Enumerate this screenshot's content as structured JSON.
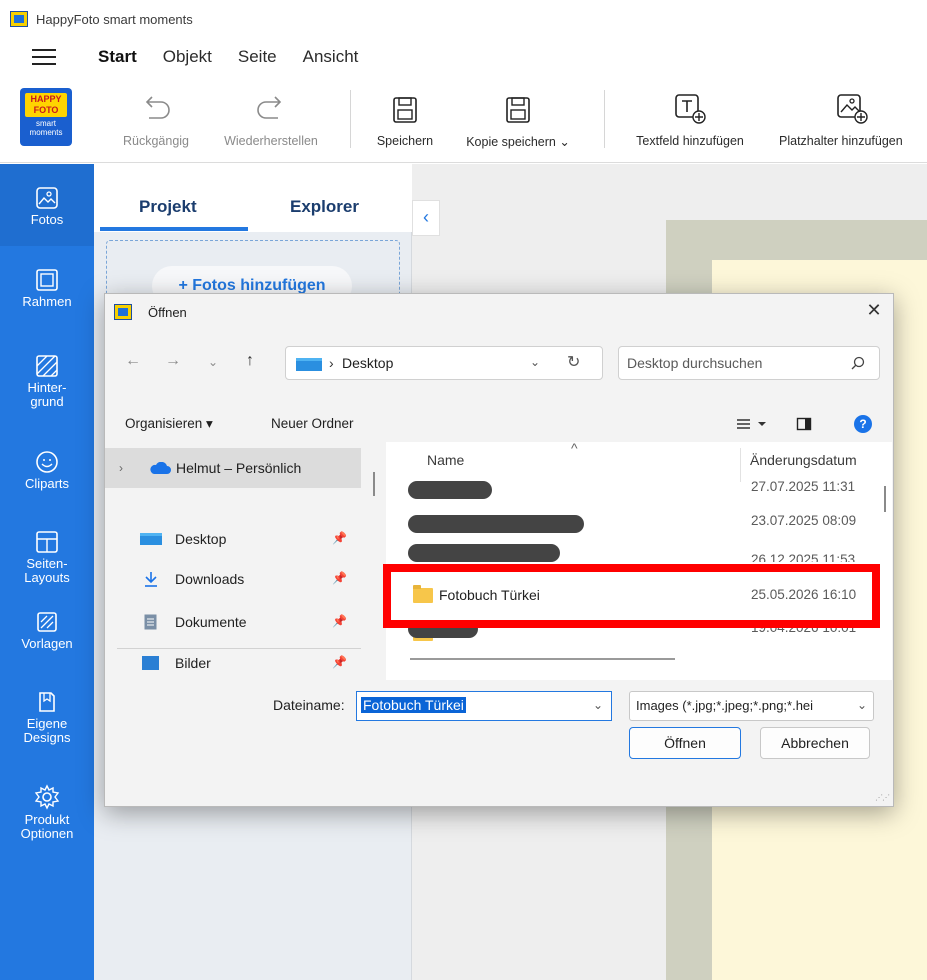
{
  "app": {
    "title": "HappyFoto smart moments"
  },
  "menu": {
    "tabs": [
      "Start",
      "Objekt",
      "Seite",
      "Ansicht"
    ]
  },
  "logo": {
    "top": "HAPPY FOTO",
    "bottom": "smart moments"
  },
  "toolbar": {
    "undo": "Rückgängig",
    "redo": "Wiederherstellen",
    "save": "Speichern",
    "save_copy": "Kopie speichern ⌄",
    "add_textfield": "Textfeld hinzufügen",
    "add_placeholder": "Platzhalter hinzufügen"
  },
  "sidebar": {
    "items": [
      {
        "label": "Fotos",
        "icon": "photo-icon"
      },
      {
        "label": "Rahmen",
        "icon": "frame-icon"
      },
      {
        "label": "Hinter-\ngrund",
        "icon": "background-icon"
      },
      {
        "label": "Cliparts",
        "icon": "clipart-icon"
      },
      {
        "label": "Seiten-\nLayouts",
        "icon": "layout-icon"
      },
      {
        "label": "Vorlagen",
        "icon": "template-icon"
      },
      {
        "label": "Eigene\nDesigns",
        "icon": "designs-icon"
      },
      {
        "label": "Produkt\nOptionen",
        "icon": "settings-icon"
      }
    ]
  },
  "panel": {
    "tabs": [
      "Projekt",
      "Explorer"
    ],
    "add_photos": "+ Fotos hinzufügen"
  },
  "dialog": {
    "title": "Öffnen",
    "address": "Desktop",
    "search_placeholder": "Desktop durchsuchen",
    "organize": "Organisieren ▾",
    "new_folder": "Neuer Ordner",
    "nav_items": [
      {
        "label": "Helmut – Persönlich",
        "selected": true
      },
      {
        "label": "Desktop"
      },
      {
        "label": "Downloads"
      },
      {
        "label": "Dokumente"
      },
      {
        "label": "Bilder"
      }
    ],
    "columns": {
      "name": "Name",
      "date": "Änderungsdatum"
    },
    "files": [
      {
        "name": "",
        "date": "27.07.2025 11:31",
        "redacted": true
      },
      {
        "name": "",
        "date": "23.07.2025 08:09",
        "redacted": true
      },
      {
        "name": "",
        "date": "26.12.2025 11:53",
        "redacted": true
      },
      {
        "name": "Fotobuch Türkei",
        "date": "25.05.2026 16:10",
        "redacted": false
      },
      {
        "name": "",
        "date": "19.04.2026 10:01",
        "redacted": true
      }
    ],
    "filename_label": "Dateiname:",
    "filename_value": "Fotobuch Türkei",
    "filetype": "Images (*.jpg;*.jpeg;*.png;*.hei",
    "open_button": "Öffnen",
    "cancel_button": "Abbrechen"
  },
  "colors": {
    "accent": "#2378e0",
    "highlight": "#ff0000",
    "folder": "#f7c64a"
  }
}
